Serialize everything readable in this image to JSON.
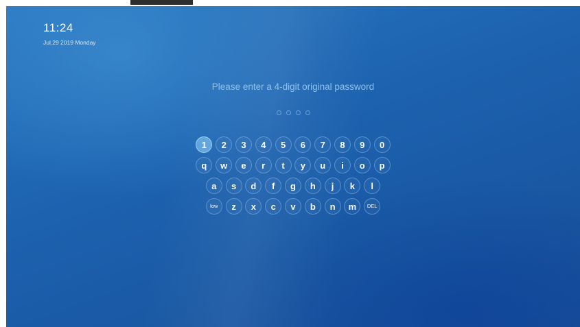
{
  "clock": {
    "time": "11:24",
    "date": "Jul.29 2019 Monday"
  },
  "prompt": "Please enter a 4-digit original password",
  "password": {
    "length": 4,
    "entered": 0
  },
  "keyboard": {
    "active_key": "1",
    "rows": [
      [
        "1",
        "2",
        "3",
        "4",
        "5",
        "6",
        "7",
        "8",
        "9",
        "0"
      ],
      [
        "q",
        "w",
        "e",
        "r",
        "t",
        "y",
        "u",
        "i",
        "o",
        "p"
      ],
      [
        "a",
        "s",
        "d",
        "f",
        "g",
        "h",
        "j",
        "k",
        "l"
      ],
      [
        "low",
        "z",
        "x",
        "c",
        "v",
        "b",
        "n",
        "m",
        "DEL"
      ]
    ]
  }
}
